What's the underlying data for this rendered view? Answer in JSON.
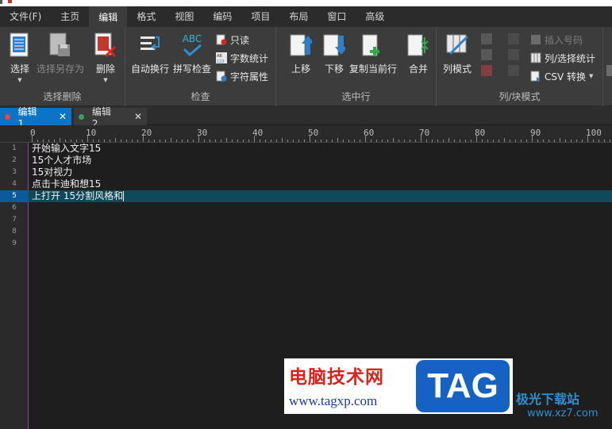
{
  "menubar": {
    "items": [
      "文件(F)",
      "主页",
      "编辑",
      "格式",
      "视图",
      "编码",
      "项目",
      "布局",
      "窗口",
      "高级"
    ],
    "active_index": 2
  },
  "ribbon": {
    "groups": {
      "select_delete": {
        "label": "选择删除",
        "select": "选择",
        "select_save_as": "选择另存为",
        "delete": "删除"
      },
      "check": {
        "label": "检查",
        "auto_wrap": "自动换行",
        "spell_check": "拼写检查",
        "readonly": "只读",
        "word_count": "字数统计",
        "char_props": "字符属性",
        "abc_text": "ABC"
      },
      "selected_lines": {
        "label": "选中行",
        "move_up": "上移",
        "move_down": "下移",
        "copy_current_line": "复制当前行",
        "merge": "合并"
      },
      "column_block": {
        "label": "列/块模式",
        "column_mode": "列模式",
        "insert_number": "插入号码",
        "column_select_stats": "列/选择统计",
        "csv_convert": "CSV 转换"
      }
    }
  },
  "tabs": [
    {
      "label": "编辑1",
      "active": true,
      "dot_color": "#e8473b"
    },
    {
      "label": "编辑2",
      "active": false,
      "dot_color": "#3a9e6a"
    }
  ],
  "tab_close_glyph": "✕",
  "editor": {
    "ruler_labels": [
      "0",
      "10",
      "20",
      "30",
      "40",
      "50",
      "60",
      "70",
      "80",
      "90",
      "100"
    ],
    "line_numbers": [
      "1",
      "2",
      "3",
      "4",
      "5",
      "6",
      "7",
      "8",
      "9"
    ],
    "current_line": 5,
    "lines": [
      "开始输入文字15",
      "15个人才市场",
      "15对视力",
      "点击卡迪和想15",
      "上打开 15分割风格和",
      "",
      "",
      "",
      ""
    ]
  },
  "watermark": {
    "title": "电脑技术网",
    "url": "www.tagxp.com",
    "tag": "TAG",
    "site2_title": "极光下载站",
    "site2_url": "www.xz7.com"
  },
  "colors": {
    "accent": "#0b74c6",
    "ribbon_bg": "#3c3c3c",
    "editor_bg": "#1e1e1e",
    "current_line_bg": "#0e4a5a"
  }
}
